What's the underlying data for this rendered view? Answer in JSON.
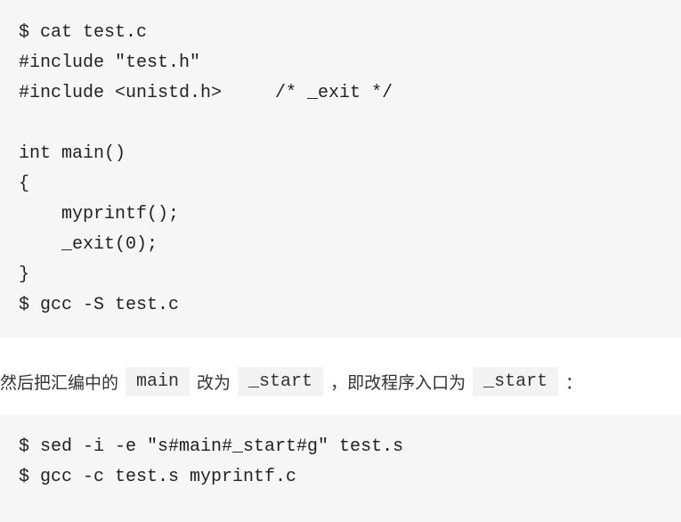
{
  "code_block_1": {
    "lines": [
      "$ cat test.c",
      "#include \"test.h\"",
      "#include <unistd.h>     /* _exit */",
      "",
      "int main()",
      "{",
      "    myprintf();",
      "    _exit(0);",
      "}",
      "$ gcc -S test.c"
    ]
  },
  "paragraph": {
    "text_1": "然后把汇编中的",
    "code_1": "main",
    "text_2": "改为",
    "code_2": "_start",
    "text_3": "，即改程序入口为",
    "code_3": "_start",
    "text_4": "："
  },
  "code_block_2": {
    "lines": [
      "$ sed -i -e \"s#main#_start#g\" test.s",
      "$ gcc -c test.s myprintf.c"
    ]
  }
}
